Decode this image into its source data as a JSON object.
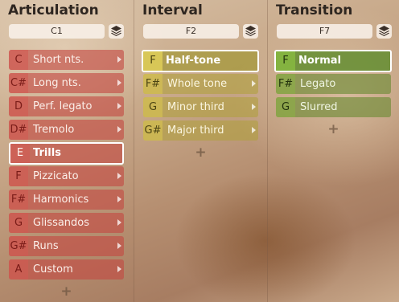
{
  "columns": [
    {
      "title": "Articulation",
      "key": "C1",
      "items": [
        {
          "key": "C",
          "label": "Short nts."
        },
        {
          "key": "C#",
          "label": "Long nts."
        },
        {
          "key": "D",
          "label": "Perf. legato"
        },
        {
          "key": "D#",
          "label": "Tremolo"
        },
        {
          "key": "E",
          "label": "Trills",
          "selected": true
        },
        {
          "key": "F",
          "label": "Pizzicato"
        },
        {
          "key": "F#",
          "label": "Harmonics"
        },
        {
          "key": "G",
          "label": "Glissandos"
        },
        {
          "key": "G#",
          "label": "Runs"
        },
        {
          "key": "A",
          "label": "Custom"
        }
      ],
      "add_label": "+"
    },
    {
      "title": "Interval",
      "key": "F2",
      "items": [
        {
          "key": "F",
          "label": "Half-tone",
          "selected": true
        },
        {
          "key": "F#",
          "label": "Whole tone"
        },
        {
          "key": "G",
          "label": "Minor third"
        },
        {
          "key": "G#",
          "label": "Major third"
        }
      ],
      "add_label": "+"
    },
    {
      "title": "Transition",
      "key": "F7",
      "items": [
        {
          "key": "F",
          "label": "Normal",
          "selected": true
        },
        {
          "key": "F#",
          "label": "Legato"
        },
        {
          "key": "G",
          "label": "Slurred"
        }
      ],
      "add_label": "+"
    }
  ],
  "icons": {
    "layers": "layers-icon",
    "submenu": "chevron-right-icon",
    "add": "plus-icon"
  },
  "colors": {
    "articulation": "#c44842",
    "interval": "#afa03c",
    "transition": "#6e8c37"
  }
}
